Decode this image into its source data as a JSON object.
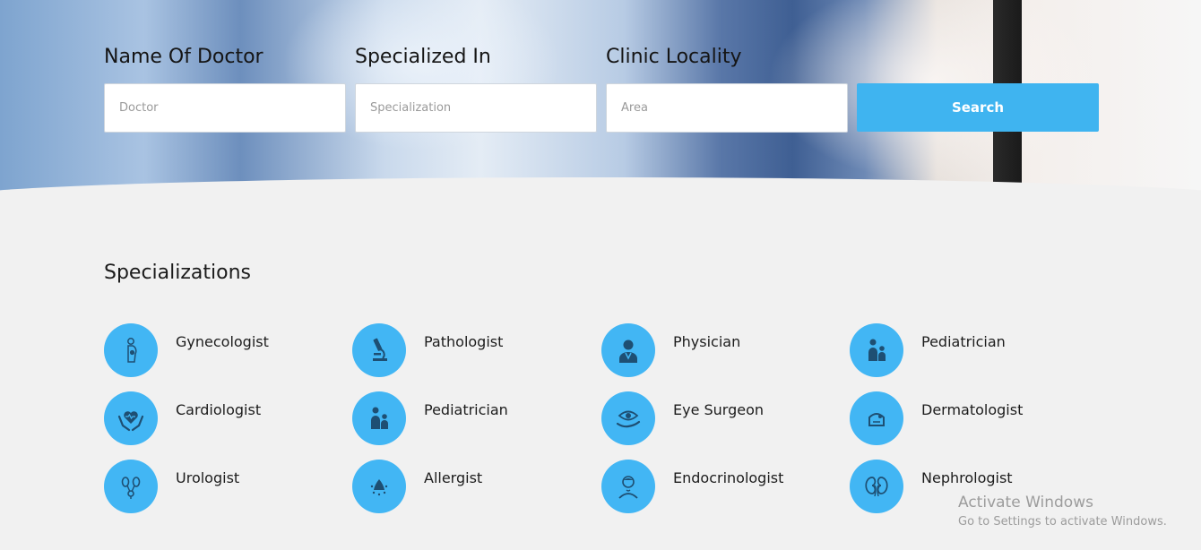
{
  "search": {
    "doctor_label": "Name Of Doctor",
    "doctor_placeholder": "Doctor",
    "specialty_label": "Specialized In",
    "specialty_placeholder": "Specialization",
    "locality_label": "Clinic Locality",
    "locality_placeholder": "Area",
    "button_label": "Search"
  },
  "specializations": {
    "title": "Specializations",
    "items": [
      {
        "label": "Gynecologist",
        "icon": "pregnant-woman-icon"
      },
      {
        "label": "Pathologist",
        "icon": "microscope-icon"
      },
      {
        "label": "Physician",
        "icon": "doctor-icon"
      },
      {
        "label": "Pediatrician",
        "icon": "pediatrician-icon"
      },
      {
        "label": "Cardiologist",
        "icon": "heart-hands-icon"
      },
      {
        "label": "Pediatrician",
        "icon": "pediatrician-icon"
      },
      {
        "label": "Eye Surgeon",
        "icon": "eye-hand-icon"
      },
      {
        "label": "Dermatologist",
        "icon": "skin-icon"
      },
      {
        "label": "Urologist",
        "icon": "urinary-system-icon"
      },
      {
        "label": "Allergist",
        "icon": "allergy-icon"
      },
      {
        "label": "Endocrinologist",
        "icon": "thyroid-patient-icon"
      },
      {
        "label": "Nephrologist",
        "icon": "kidneys-icon"
      }
    ]
  },
  "watermark": {
    "line1": "Activate Windows",
    "line2": "Go to Settings to activate Windows."
  },
  "colors": {
    "accent": "#42b6f4",
    "button": "#3fb4f0",
    "background": "#f1f1f1"
  }
}
